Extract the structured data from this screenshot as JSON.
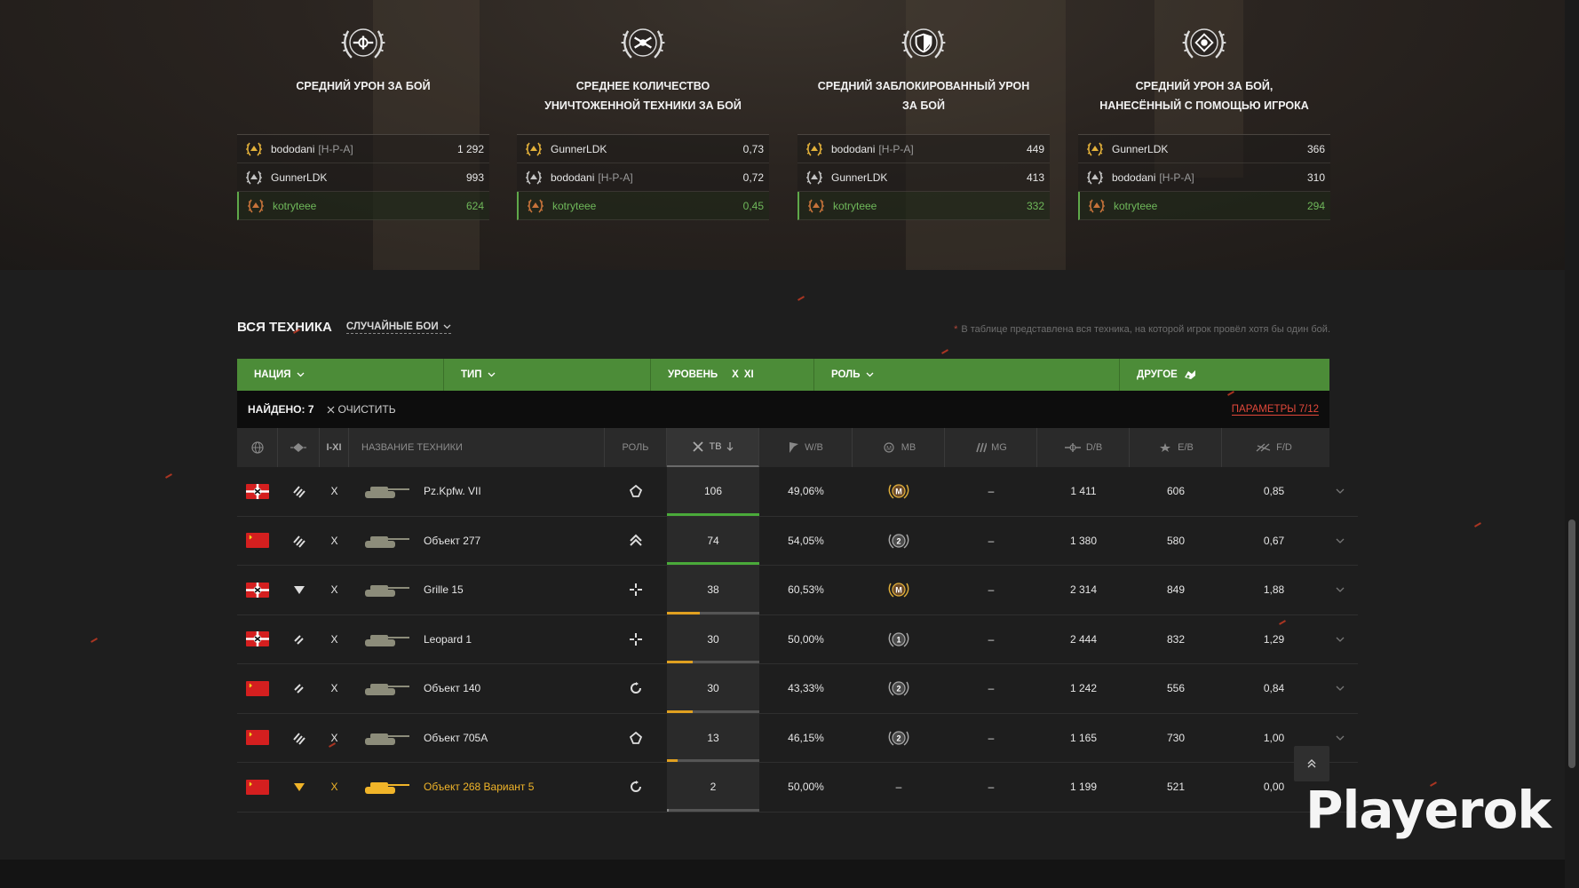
{
  "stats": [
    {
      "title": "Средний урон за бой",
      "icon": "damage-icon",
      "rows": [
        {
          "medal": "gold",
          "name": "bododani",
          "clan": "[H-P-A]",
          "value": "1 292",
          "me": false
        },
        {
          "medal": "silver",
          "name": "GunnerLDK",
          "clan": "",
          "value": "993",
          "me": false
        },
        {
          "medal": "bronze",
          "name": "kotryteee",
          "clan": "",
          "value": "624",
          "me": true
        }
      ]
    },
    {
      "title": "Среднее количество уничтоженной техники за бой",
      "icon": "frags-icon",
      "rows": [
        {
          "medal": "gold",
          "name": "GunnerLDK",
          "clan": "",
          "value": "0,73",
          "me": false
        },
        {
          "medal": "silver",
          "name": "bododani",
          "clan": "[H-P-A]",
          "value": "0,72",
          "me": false
        },
        {
          "medal": "bronze",
          "name": "kotryteee",
          "clan": "",
          "value": "0,45",
          "me": true
        }
      ]
    },
    {
      "title": "Средний заблокированный урон за бой",
      "icon": "shield-icon",
      "rows": [
        {
          "medal": "gold",
          "name": "bododani",
          "clan": "[H-P-A]",
          "value": "449",
          "me": false
        },
        {
          "medal": "silver",
          "name": "GunnerLDK",
          "clan": "",
          "value": "413",
          "me": false
        },
        {
          "medal": "bronze",
          "name": "kotryteee",
          "clan": "",
          "value": "332",
          "me": true
        }
      ]
    },
    {
      "title": "Средний урон за бой, нанесённый с помощью игрока",
      "icon": "assist-icon",
      "rows": [
        {
          "medal": "gold",
          "name": "GunnerLDK",
          "clan": "",
          "value": "366",
          "me": false
        },
        {
          "medal": "silver",
          "name": "bododani",
          "clan": "[H-P-A]",
          "value": "310",
          "me": false
        },
        {
          "medal": "bronze",
          "name": "kotryteee",
          "clan": "",
          "value": "294",
          "me": true
        }
      ]
    }
  ],
  "vehicles": {
    "title": "ВСЯ ТЕХНИКА",
    "mode": "СЛУЧАЙНЫЕ БОИ",
    "note": "В таблице представлена вся техника, на которой игрок провёл хотя бы один бой.",
    "filters": {
      "nation": "НАЦИЯ",
      "type": "ТИП",
      "level": "УРОВЕНЬ",
      "level_x": "X",
      "level_xi": "XI",
      "role": "РОЛЬ",
      "other": "ДРУГОЕ"
    },
    "found": "НАЙДЕНО: 7",
    "clear": "ОЧИСТИТЬ",
    "params": "ПАРАМЕТРЫ 7/12",
    "columns": {
      "tier": "I-XI",
      "name": "НАЗВАНИЕ ТЕХНИКИ",
      "role": "РОЛЬ",
      "battles": "ТВ",
      "winrate": "W/B",
      "mastery": "MB",
      "mg": "MG",
      "damage": "D/B",
      "exp": "E/B",
      "frags": "F/D"
    },
    "rows": [
      {
        "nation": "germany",
        "type": "heavy",
        "tier": "X",
        "name": "Pz.Kpfw. VII",
        "role": "break",
        "battles": "106",
        "battles_frac": 1.0,
        "bar_color": "#4aaa3a",
        "winrate": "49,06%",
        "mastery": "M",
        "mg": "–",
        "damage": "1 411",
        "exp": "606",
        "frags": "0,85",
        "gold": false
      },
      {
        "nation": "ussr",
        "type": "heavy",
        "tier": "X",
        "name": "Объект 277",
        "role": "versatile",
        "battles": "74",
        "battles_frac": 1.0,
        "bar_color": "#4aaa3a",
        "winrate": "54,05%",
        "mastery": "2",
        "mg": "–",
        "damage": "1 380",
        "exp": "580",
        "frags": "0,67",
        "gold": false
      },
      {
        "nation": "germany",
        "type": "spg",
        "tier": "X",
        "name": "Grille 15",
        "role": "sniper",
        "battles": "38",
        "battles_frac": 0.36,
        "bar_color": "#e0a020",
        "winrate": "60,53%",
        "mastery": "M",
        "mg": "–",
        "damage": "2 314",
        "exp": "849",
        "frags": "1,88",
        "gold": false
      },
      {
        "nation": "germany",
        "type": "medium",
        "tier": "X",
        "name": "Leopard 1",
        "role": "sniper",
        "battles": "30",
        "battles_frac": 0.28,
        "bar_color": "#e0a020",
        "winrate": "50,00%",
        "mastery": "1",
        "mg": "–",
        "damage": "2 444",
        "exp": "832",
        "frags": "1,29",
        "gold": false
      },
      {
        "nation": "ussr",
        "type": "medium",
        "tier": "X",
        "name": "Объект 140",
        "role": "support",
        "battles": "30",
        "battles_frac": 0.28,
        "bar_color": "#e0a020",
        "winrate": "43,33%",
        "mastery": "2",
        "mg": "–",
        "damage": "1 242",
        "exp": "556",
        "frags": "0,84",
        "gold": false
      },
      {
        "nation": "ussr",
        "type": "heavy",
        "tier": "X",
        "name": "Объект 705А",
        "role": "break",
        "battles": "13",
        "battles_frac": 0.12,
        "bar_color": "#e0a020",
        "winrate": "46,15%",
        "mastery": "2",
        "mg": "–",
        "damage": "1 165",
        "exp": "730",
        "frags": "1,00",
        "gold": false
      },
      {
        "nation": "ussr",
        "type": "spg",
        "tier": "X",
        "name": "Объект 268 Вариант 5",
        "role": "support",
        "battles": "2",
        "battles_frac": 0.02,
        "bar_color": "#888888",
        "winrate": "50,00%",
        "mastery": "–",
        "mg": "–",
        "damage": "1 199",
        "exp": "521",
        "frags": "0,00",
        "gold": true
      }
    ]
  },
  "watermark": "Playerok"
}
